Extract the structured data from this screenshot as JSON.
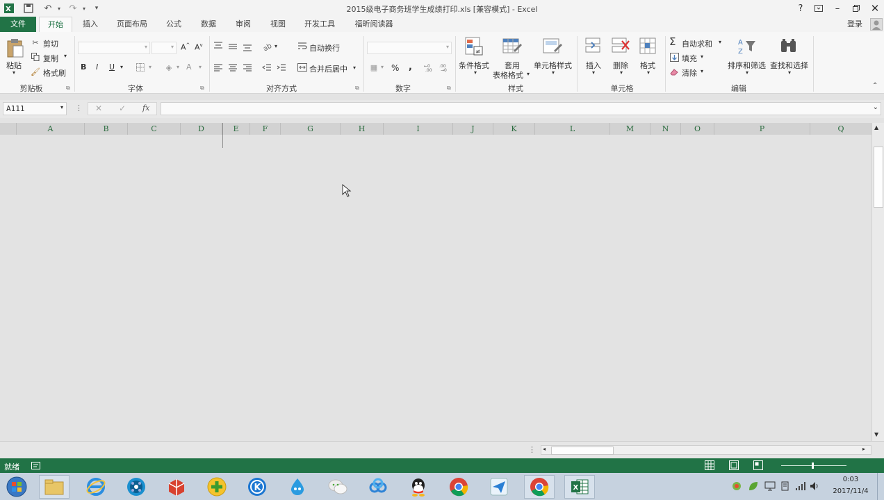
{
  "window": {
    "title": "2015级电子商务班学生成绩打印.xls  [兼容模式] - Excel",
    "help": "?",
    "login": "登录"
  },
  "tabs": [
    "文件",
    "开始",
    "插入",
    "页面布局",
    "公式",
    "数据",
    "审阅",
    "视图",
    "开发工具",
    "福昕阅读器"
  ],
  "ribbon": {
    "clipboard": {
      "group": "剪贴板",
      "paste": "粘贴",
      "cut": "剪切",
      "copy": "复制",
      "format_painter": "格式刷"
    },
    "font": {
      "group": "字体",
      "bold": "B",
      "italic": "I",
      "underline": "U"
    },
    "alignment": {
      "group": "对齐方式",
      "wrap_text": "自动换行",
      "merge_center": "合并后居中"
    },
    "number": {
      "group": "数字",
      "percent": "%",
      "comma": ","
    },
    "styles": {
      "group": "样式",
      "conditional": "条件格式",
      "table_line1": "套用",
      "table_line2": "表格格式",
      "cell_styles": "单元格样式"
    },
    "cells": {
      "group": "单元格",
      "insert": "插入",
      "delete": "删除",
      "format": "格式"
    },
    "editing": {
      "group": "编辑",
      "autosum": "自动求和",
      "fill": "填充",
      "clear": "清除",
      "sort_filter": "排序和筛选",
      "find_select": "查找和选择"
    }
  },
  "formula_bar": {
    "name_box": "A111",
    "fx": "fx",
    "content": ""
  },
  "columns": [
    "A",
    "B",
    "C",
    "D",
    "E",
    "F",
    "G",
    "H",
    "I",
    "J",
    "K",
    "L",
    "M",
    "N",
    "O",
    "P",
    "Q"
  ],
  "status": {
    "ready": "就绪"
  },
  "taskbar": {
    "time": "0:03",
    "date": "2017/11/4"
  },
  "colors": {
    "excel_green": "#217346",
    "ribbon_bg": "#f7f7f7",
    "grid_bg": "#e3e3e3"
  }
}
